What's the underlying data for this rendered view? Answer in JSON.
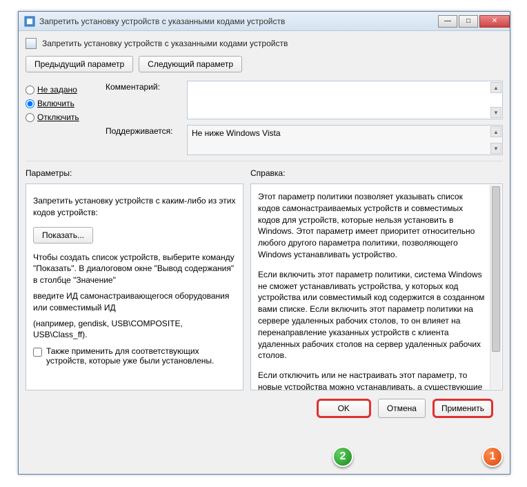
{
  "window": {
    "title": "Запретить установку устройств с указанными кодами устройств"
  },
  "header": {
    "title": "Запретить установку устройств с указанными кодами устройств"
  },
  "nav": {
    "prev": "Предыдущий параметр",
    "next": "Следующий параметр"
  },
  "state": {
    "not_configured": "Не задано",
    "enabled": "Включить",
    "disabled": "Отключить",
    "selected": "enabled"
  },
  "fields": {
    "comment_label": "Комментарий:",
    "comment_value": "",
    "supported_label": "Поддерживается:",
    "supported_value": "Не ниже Windows Vista"
  },
  "section_labels": {
    "params": "Параметры:",
    "help": "Справка:"
  },
  "params": {
    "heading": "Запретить установку устройств с каким-либо из этих кодов устройств:",
    "show_btn": "Показать...",
    "p1": "Чтобы создать список устройств, выберите команду \"Показать\". В диалоговом окне \"Вывод содержания\" в столбце \"Значение\"",
    "p2": "введите ИД самонастраивающегося оборудования или совместимый ИД",
    "p3": "(например, gendisk, USB\\COMPOSITE, USB\\Class_ff).",
    "chk_label": "Также применить для соответствующих устройств, которые уже были установлены."
  },
  "help": {
    "p1": "Этот параметр политики позволяет указывать список кодов самонастраиваемых устройств и совместимых кодов для устройств, которые нельзя установить в Windows. Этот параметр имеет приоритет относительно любого другого параметра политики, позволяющего Windows устанавливать устройство.",
    "p2": "Если включить этот параметр политики, система Windows не сможет устанавливать устройства, у которых код устройства или совместимый код содержится в созданном вами списке. Если включить этот параметр политики на сервере удаленных рабочих столов, то он влияет на перенаправление указанных устройств с клиента удаленных рабочих столов на сервер удаленных рабочих столов.",
    "p3": "Если отключить или не настраивать этот параметр, то новые устройства можно устанавливать, а существующие обновлять, насколько это разрешено или запрещено другими параметрами политики."
  },
  "footer": {
    "ok": "OK",
    "cancel": "Отмена",
    "apply": "Применить"
  },
  "markers": {
    "m1": "1",
    "m2": "2"
  }
}
